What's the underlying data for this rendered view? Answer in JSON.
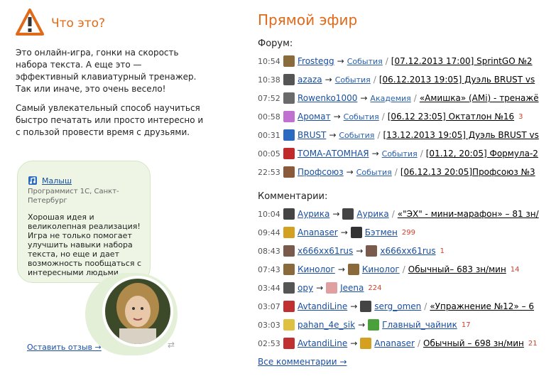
{
  "about": {
    "title": "Что это?",
    "p1": "Это онлайн-игра, гонки на скорость набора текста. А еще это — эффективный клавиатурный тренажер. Так или иначе, это очень весело!",
    "p2": "Самый увлекательный способ научиться быстро печатать или просто интересно и с пользой провести время с друзьями."
  },
  "review": {
    "name": "Малыш",
    "job": "Программист 1С, Санкт-Петербург",
    "text": "Хорошая идея и великолепная реализация! Игра не только помогает улучшить навыки набора текста, но еще и дает возможность пообщаться с интересными людьми.",
    "leave_link": "Оставить отзыв →"
  },
  "live": {
    "title": "Прямой эфир",
    "forum_label": "Форум:",
    "comments_label": "Комментарии:",
    "all_comments": "Все комментарии →",
    "forum": [
      {
        "time": "10:54",
        "user": "Frostegg",
        "cat": "События",
        "topic": "[07.12.2013 17:00] SprintGO №2",
        "color": "#8a6b3b"
      },
      {
        "time": "10:38",
        "user": "azaza",
        "cat": "События",
        "topic": "[06.12.2013 19:05] Дуэль BRUST vs",
        "color": "#555555"
      },
      {
        "time": "07:52",
        "user": "Rowenko1000",
        "cat": "Академия",
        "topic": "«Амишка» (AMi) - тренажё",
        "color": "#6a6a6a"
      },
      {
        "time": "00:58",
        "user": "Аромат",
        "cat": "События",
        "topic": "[06.12 23:05] Октатлон №16",
        "count": "3",
        "color": "#c070d0"
      },
      {
        "time": "00:31",
        "user": "BRUST",
        "cat": "События",
        "topic": "[13.12.2013 19:05] Дуэль BRUST vs",
        "color": "#2a6ac0"
      },
      {
        "time": "00:05",
        "user": "ТОМА-АТОМНАЯ",
        "cat": "События",
        "topic": "[01.12, 20:05] Формула-2",
        "color": "#c02a2a"
      },
      {
        "time": "22:53",
        "user": "Профсоюз",
        "cat": "События",
        "topic": "[06.12.13 20:05]Профсоюз №3",
        "color": "#8a5a3a"
      }
    ],
    "comments": [
      {
        "time": "10:04",
        "from": "Аурика",
        "to": "Аурика",
        "topic": "«\"ЭХ\" - мини-марафон» – 81 зн/",
        "from_color": "#444",
        "to_color": "#444",
        "sep": true
      },
      {
        "time": "09:44",
        "from": "Ananaser",
        "to": "Бэтмен",
        "count": "299",
        "from_color": "#d4a020",
        "to_color": "#333"
      },
      {
        "time": "08:43",
        "from": "x666xx61rus",
        "to": "x666xx61rus",
        "count": "1",
        "from_color": "#7a5a4a",
        "to_color": "#7a5a4a"
      },
      {
        "time": "07:43",
        "from": "Кинолог",
        "to": "Кинолог",
        "topic": "Обычный– 683 зн/мин",
        "count": "14",
        "from_color": "#8a6a3a",
        "to_color": "#8a6a3a",
        "sep": true
      },
      {
        "time": "03:44",
        "from": "ору",
        "to": "Jeena",
        "count": "224",
        "from_color": "#555",
        "to_color": "#e0a0a0"
      },
      {
        "time": "03:07",
        "from": "AvtandiLine",
        "to": "serg_omen",
        "topic": "«Упражнение №12» – 6",
        "from_color": "#c03030",
        "to_color": "#444",
        "sep": true
      },
      {
        "time": "03:03",
        "from": "pahan_4e_sik",
        "to": "Главный_чайник",
        "count": "17",
        "from_color": "#e0c040",
        "to_color": "#4aa03a"
      },
      {
        "time": "02:53",
        "from": "AvtandiLine",
        "to": "Ananaser",
        "topic": "Обычный – 698 зн/мин",
        "count": "21",
        "from_color": "#c03030",
        "to_color": "#d4a020",
        "sep": true
      }
    ]
  }
}
